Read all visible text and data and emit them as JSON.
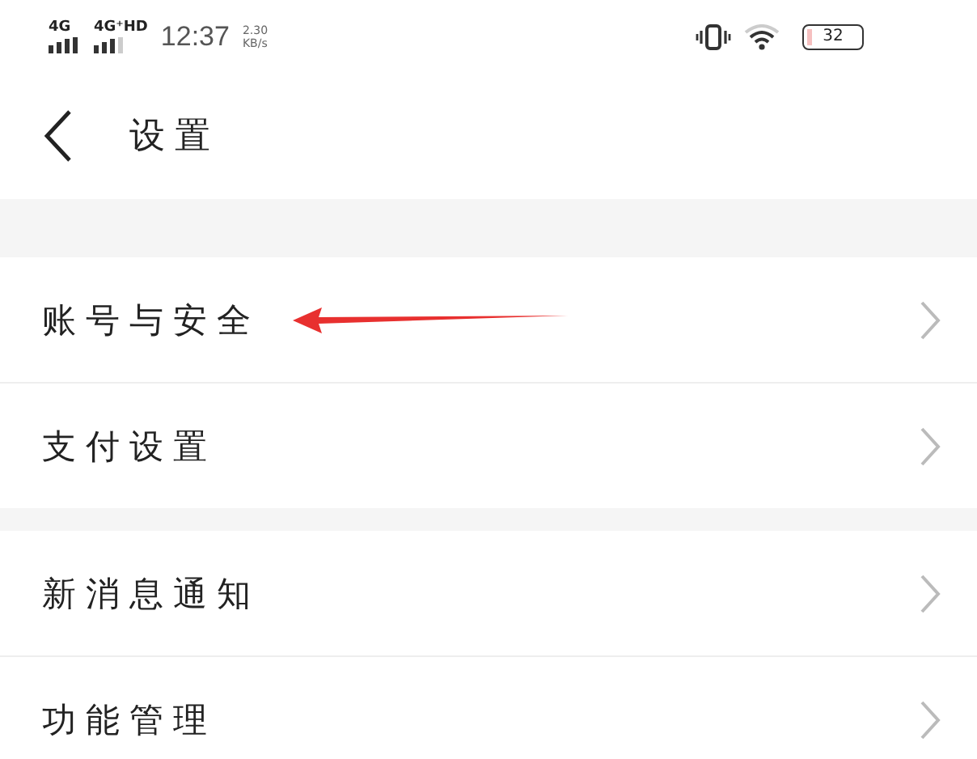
{
  "status_bar": {
    "network_1": "4G",
    "network_2": "4G⁺HD",
    "time": "12:37",
    "speed_value": "2.30",
    "speed_unit": "KB/s",
    "battery": "32"
  },
  "header": {
    "title": "设置"
  },
  "sections": [
    {
      "items": [
        {
          "label": "账号与安全",
          "annotated": true
        },
        {
          "label": "支付设置",
          "annotated": false
        }
      ]
    },
    {
      "items": [
        {
          "label": "新消息通知",
          "annotated": false
        },
        {
          "label": "功能管理",
          "annotated": false
        }
      ]
    }
  ]
}
